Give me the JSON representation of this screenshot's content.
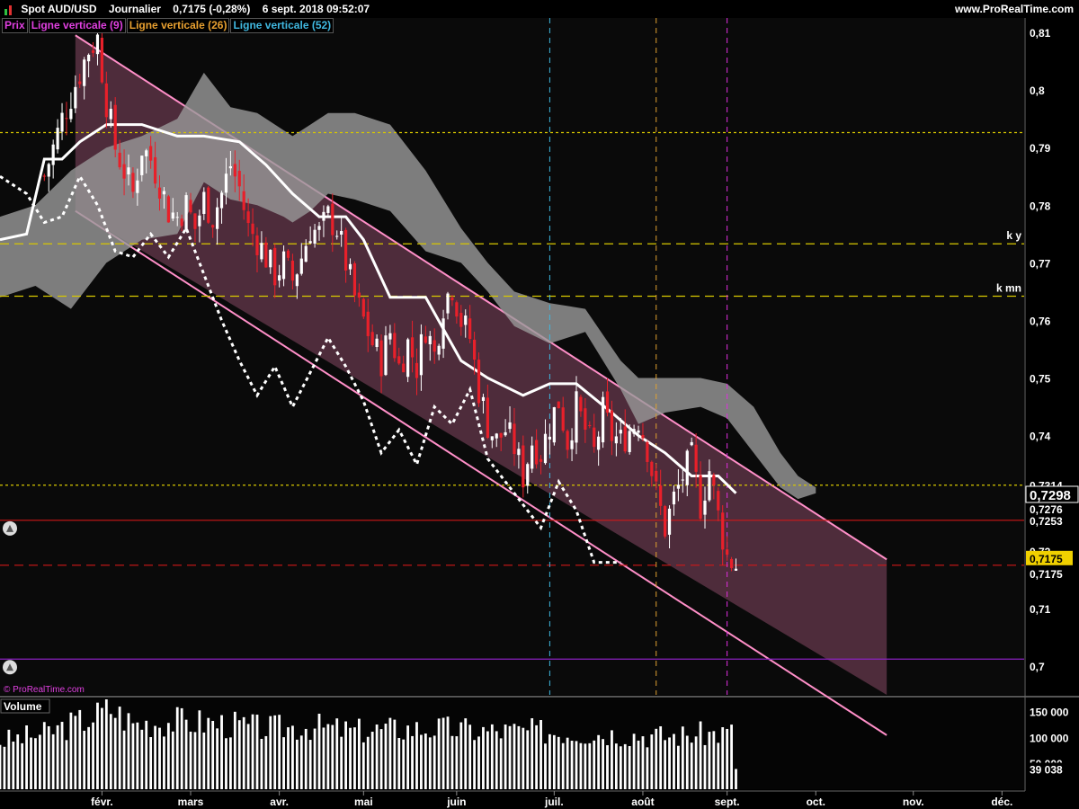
{
  "header": {
    "title": "Spot AUD/USD",
    "timeframe": "Journalier",
    "price_change": "0,7175 (-0,28%)",
    "datetime": "6 sept. 2018 09:52:07",
    "brand": "www.ProRealTime.com",
    "watermark": "© ProRealTime.com"
  },
  "legend": {
    "prix": "Prix",
    "ligne9": "Ligne verticale (9)",
    "ligne26": "Ligne verticale (26)",
    "ligne52": "Ligne verticale (52)"
  },
  "colors": {
    "up_candle": "#ffffff",
    "down_candle": "#e8202a",
    "channel_line": "#ff8fc8",
    "channel_fill": "#5a3344",
    "cloud_fill": "#9a9a9a",
    "hline_yellow": "#d8c800",
    "hline_red": "#d01818",
    "hline_purple": "#8a20c0",
    "vline_cyan": "#40b8e0",
    "vline_orange": "#e0a030",
    "vline_magenta": "#e030e0",
    "axis_text": "#ffffff",
    "price_badge": "#f0d000"
  },
  "volume": {
    "label": "Volume",
    "last_value": "39 038"
  },
  "chart_data": {
    "type": "candlestick",
    "title": "Spot AUD/USD",
    "price_axis": {
      "ylim": [
        0.695,
        0.8125
      ],
      "ticks": [
        0.81,
        0.8,
        0.79,
        0.78,
        0.77,
        0.76,
        0.75,
        0.74,
        0.73,
        0.72,
        0.71,
        0.7
      ],
      "tick_labels": [
        "0,81",
        "0,8",
        "0,79",
        "0,78",
        "0,77",
        "0,76",
        "0,75",
        "0,74",
        "0,73",
        "0,72",
        "0,71",
        "0,7"
      ]
    },
    "time_axis": {
      "labels": [
        "févr.",
        "mars",
        "avr.",
        "mai",
        "juin",
        "juil.",
        "août",
        "sept.",
        "oct.",
        "nov.",
        "déc."
      ],
      "label_day_index": [
        23,
        43,
        63,
        82,
        103,
        125,
        145,
        164,
        184,
        206,
        226
      ],
      "last_day_index": 166,
      "total_days": 231
    },
    "horizontal_lines": [
      {
        "value": 0.7926,
        "color": "yellow",
        "style": "dashed-fine",
        "label": ""
      },
      {
        "value": 0.7733,
        "color": "yellow",
        "style": "dashed",
        "label": "k y"
      },
      {
        "value": 0.7642,
        "color": "yellow",
        "style": "dashed",
        "label": "k mn"
      },
      {
        "value": 0.7314,
        "color": "yellow",
        "style": "dashed-fine",
        "label": "0,7314"
      },
      {
        "value": 0.7253,
        "color": "red",
        "style": "solid",
        "label": "0,7253"
      },
      {
        "value": 0.7175,
        "color": "red",
        "style": "dashed",
        "label": "0,7175"
      },
      {
        "value": 0.7012,
        "color": "purple",
        "style": "solid",
        "label": ""
      }
    ],
    "price_labels": {
      "current": "0,7298",
      "ichimoku_a": "0,7276",
      "last_badge": "0,7175",
      "partial_0_72": "0,72"
    },
    "vertical_lines": [
      {
        "day": 124,
        "color": "cyan",
        "name": "Ligne verticale (52)"
      },
      {
        "day": 148,
        "color": "orange",
        "name": "Ligne verticale (26)"
      },
      {
        "day": 164,
        "color": "magenta",
        "name": "Ligne verticale (9)"
      }
    ],
    "channel": {
      "start_day": 17,
      "end_day": 200,
      "upper_start": 0.8095,
      "upper_end": 0.7185,
      "lower_start": 0.779,
      "lower_end": 0.688
    },
    "close_path": [
      [
        10,
        0.785
      ],
      [
        14,
        0.795
      ],
      [
        18,
        0.803
      ],
      [
        20,
        0.807
      ],
      [
        22,
        0.809
      ],
      [
        24,
        0.798
      ],
      [
        26,
        0.79
      ],
      [
        28,
        0.786
      ],
      [
        30,
        0.782
      ],
      [
        32,
        0.79
      ],
      [
        34,
        0.788
      ],
      [
        36,
        0.784
      ],
      [
        38,
        0.779
      ],
      [
        40,
        0.778
      ],
      [
        42,
        0.78
      ],
      [
        44,
        0.776
      ],
      [
        46,
        0.781
      ],
      [
        48,
        0.778
      ],
      [
        50,
        0.782
      ],
      [
        52,
        0.787
      ],
      [
        54,
        0.783
      ],
      [
        56,
        0.776
      ],
      [
        58,
        0.774
      ],
      [
        60,
        0.771
      ],
      [
        62,
        0.768
      ],
      [
        64,
        0.77
      ],
      [
        66,
        0.767
      ],
      [
        68,
        0.771
      ],
      [
        70,
        0.776
      ],
      [
        72,
        0.775
      ],
      [
        74,
        0.778
      ],
      [
        76,
        0.776
      ],
      [
        78,
        0.77
      ],
      [
        80,
        0.764
      ],
      [
        82,
        0.76
      ],
      [
        84,
        0.756
      ],
      [
        86,
        0.753
      ],
      [
        88,
        0.758
      ],
      [
        90,
        0.752
      ],
      [
        92,
        0.756
      ],
      [
        94,
        0.752
      ],
      [
        96,
        0.759
      ],
      [
        98,
        0.754
      ],
      [
        100,
        0.763
      ],
      [
        102,
        0.766
      ],
      [
        104,
        0.76
      ],
      [
        106,
        0.757
      ],
      [
        108,
        0.748
      ],
      [
        110,
        0.742
      ],
      [
        112,
        0.739
      ],
      [
        114,
        0.741
      ],
      [
        116,
        0.738
      ],
      [
        118,
        0.733
      ],
      [
        120,
        0.739
      ],
      [
        122,
        0.737
      ],
      [
        124,
        0.742
      ],
      [
        126,
        0.746
      ],
      [
        128,
        0.739
      ],
      [
        130,
        0.745
      ],
      [
        132,
        0.741
      ],
      [
        134,
        0.737
      ],
      [
        136,
        0.744
      ],
      [
        138,
        0.74
      ],
      [
        140,
        0.739
      ],
      [
        142,
        0.741
      ],
      [
        144,
        0.743
      ],
      [
        146,
        0.738
      ],
      [
        148,
        0.73
      ],
      [
        150,
        0.724
      ],
      [
        152,
        0.729
      ],
      [
        154,
        0.733
      ],
      [
        156,
        0.736
      ],
      [
        158,
        0.728
      ],
      [
        160,
        0.734
      ],
      [
        162,
        0.726
      ],
      [
        164,
        0.719
      ],
      [
        166,
        0.7175
      ]
    ],
    "cloud_top": [
      [
        0,
        0.778
      ],
      [
        8,
        0.78
      ],
      [
        16,
        0.786
      ],
      [
        24,
        0.79
      ],
      [
        32,
        0.792
      ],
      [
        40,
        0.795
      ],
      [
        46,
        0.803
      ],
      [
        52,
        0.797
      ],
      [
        58,
        0.796
      ],
      [
        64,
        0.793
      ],
      [
        66,
        0.792
      ],
      [
        70,
        0.794
      ],
      [
        74,
        0.796
      ],
      [
        80,
        0.796
      ],
      [
        88,
        0.794
      ],
      [
        96,
        0.786
      ],
      [
        104,
        0.776
      ],
      [
        110,
        0.77
      ],
      [
        116,
        0.765
      ],
      [
        124,
        0.763
      ],
      [
        132,
        0.762
      ],
      [
        140,
        0.753
      ],
      [
        144,
        0.75
      ],
      [
        150,
        0.75
      ],
      [
        158,
        0.75
      ],
      [
        164,
        0.749
      ],
      [
        170,
        0.745
      ],
      [
        176,
        0.737
      ],
      [
        180,
        0.733
      ],
      [
        184,
        0.731
      ]
    ],
    "cloud_bottom": [
      [
        0,
        0.764
      ],
      [
        8,
        0.766
      ],
      [
        16,
        0.762
      ],
      [
        24,
        0.77
      ],
      [
        32,
        0.774
      ],
      [
        40,
        0.775
      ],
      [
        46,
        0.784
      ],
      [
        52,
        0.781
      ],
      [
        58,
        0.78
      ],
      [
        64,
        0.778
      ],
      [
        66,
        0.777
      ],
      [
        70,
        0.779
      ],
      [
        74,
        0.782
      ],
      [
        80,
        0.781
      ],
      [
        88,
        0.779
      ],
      [
        96,
        0.772
      ],
      [
        104,
        0.77
      ],
      [
        110,
        0.765
      ],
      [
        116,
        0.759
      ],
      [
        124,
        0.756
      ],
      [
        132,
        0.758
      ],
      [
        140,
        0.748
      ],
      [
        144,
        0.742
      ],
      [
        150,
        0.744
      ],
      [
        158,
        0.745
      ],
      [
        164,
        0.743
      ],
      [
        170,
        0.737
      ],
      [
        176,
        0.731
      ],
      [
        180,
        0.729
      ],
      [
        184,
        0.73
      ]
    ],
    "kijun": [
      [
        0,
        0.774
      ],
      [
        6,
        0.775
      ],
      [
        10,
        0.788
      ],
      [
        14,
        0.788
      ],
      [
        18,
        0.791
      ],
      [
        24,
        0.794
      ],
      [
        32,
        0.794
      ],
      [
        40,
        0.792
      ],
      [
        46,
        0.792
      ],
      [
        54,
        0.791
      ],
      [
        60,
        0.787
      ],
      [
        66,
        0.782
      ],
      [
        72,
        0.778
      ],
      [
        78,
        0.778
      ],
      [
        82,
        0.774
      ],
      [
        88,
        0.764
      ],
      [
        96,
        0.764
      ],
      [
        104,
        0.753
      ],
      [
        110,
        0.75
      ],
      [
        118,
        0.747
      ],
      [
        124,
        0.749
      ],
      [
        130,
        0.749
      ],
      [
        138,
        0.744
      ],
      [
        144,
        0.74
      ],
      [
        150,
        0.737
      ],
      [
        156,
        0.733
      ],
      [
        162,
        0.733
      ],
      [
        166,
        0.73
      ]
    ],
    "chikou": [
      [
        0,
        0.785
      ],
      [
        6,
        0.782
      ],
      [
        10,
        0.777
      ],
      [
        14,
        0.778
      ],
      [
        18,
        0.785
      ],
      [
        22,
        0.78
      ],
      [
        26,
        0.772
      ],
      [
        30,
        0.771
      ],
      [
        34,
        0.775
      ],
      [
        38,
        0.771
      ],
      [
        42,
        0.776
      ],
      [
        46,
        0.768
      ],
      [
        50,
        0.76
      ],
      [
        54,
        0.753
      ],
      [
        58,
        0.747
      ],
      [
        62,
        0.752
      ],
      [
        66,
        0.745
      ],
      [
        70,
        0.751
      ],
      [
        74,
        0.757
      ],
      [
        78,
        0.752
      ],
      [
        82,
        0.746
      ],
      [
        86,
        0.737
      ],
      [
        90,
        0.741
      ],
      [
        94,
        0.735
      ],
      [
        98,
        0.745
      ],
      [
        102,
        0.742
      ],
      [
        106,
        0.748
      ],
      [
        110,
        0.736
      ],
      [
        114,
        0.732
      ],
      [
        118,
        0.728
      ],
      [
        122,
        0.724
      ],
      [
        126,
        0.732
      ],
      [
        130,
        0.727
      ],
      [
        134,
        0.718
      ],
      [
        138,
        0.718
      ],
      [
        140,
        0.718
      ]
    ],
    "volume_axis": {
      "ticks": [
        150000,
        100000,
        50000
      ],
      "tick_labels": [
        "150 000",
        "100 000",
        "50 000"
      ]
    },
    "volume_profile": [
      [
        0,
        95000
      ],
      [
        10,
        110000
      ],
      [
        20,
        140000
      ],
      [
        25,
        160000
      ],
      [
        30,
        130000
      ],
      [
        40,
        135000
      ],
      [
        50,
        130000
      ],
      [
        60,
        120000
      ],
      [
        70,
        125000
      ],
      [
        80,
        115000
      ],
      [
        90,
        120000
      ],
      [
        100,
        120000
      ],
      [
        110,
        115000
      ],
      [
        120,
        115000
      ],
      [
        130,
        112000
      ],
      [
        140,
        110000
      ],
      [
        150,
        105000
      ],
      [
        160,
        110000
      ],
      [
        165,
        112000
      ],
      [
        166,
        39038
      ]
    ]
  }
}
